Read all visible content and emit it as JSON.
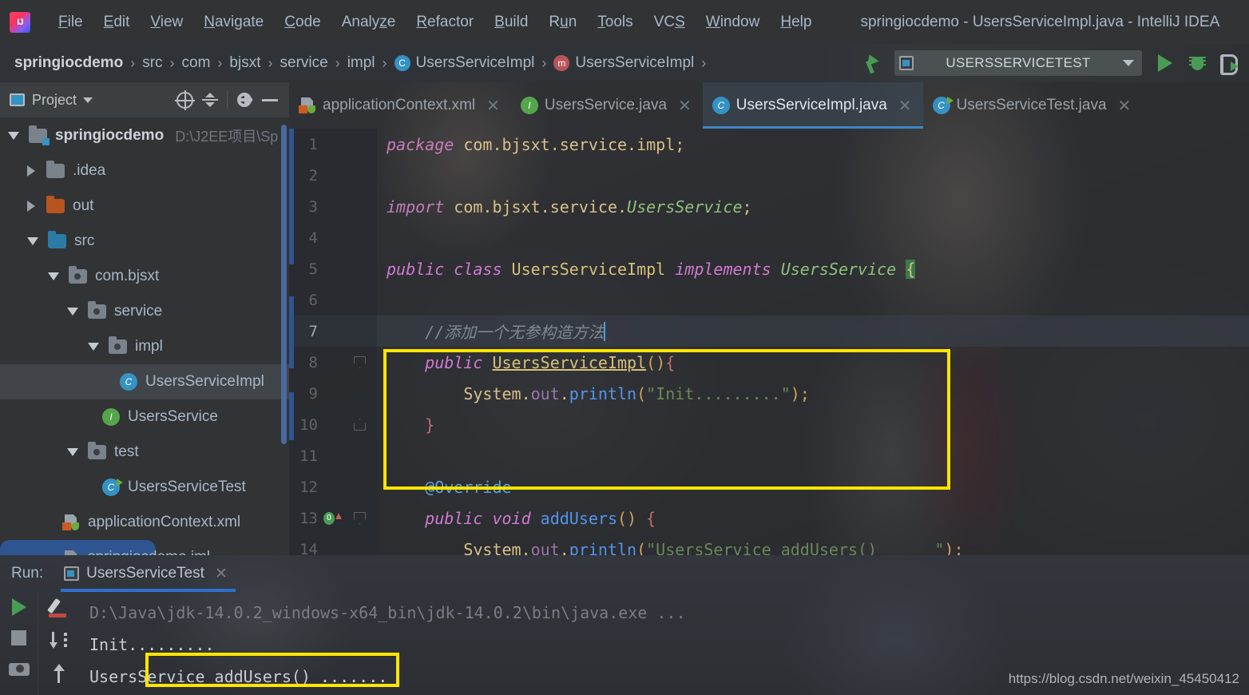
{
  "window": {
    "title": "springiocdemo - UsersServiceImpl.java - IntelliJ IDEA",
    "logo_icon": "intellij-idea-logo"
  },
  "menubar": {
    "items": [
      {
        "label": "File",
        "mnemonic": "F"
      },
      {
        "label": "Edit",
        "mnemonic": "E"
      },
      {
        "label": "View",
        "mnemonic": "V"
      },
      {
        "label": "Navigate",
        "mnemonic": "N"
      },
      {
        "label": "Code",
        "mnemonic": "C"
      },
      {
        "label": "Analyze",
        "mnemonic": "z"
      },
      {
        "label": "Refactor",
        "mnemonic": "R"
      },
      {
        "label": "Build",
        "mnemonic": "B"
      },
      {
        "label": "Run",
        "mnemonic": "u"
      },
      {
        "label": "Tools",
        "mnemonic": "T"
      },
      {
        "label": "VCS",
        "mnemonic": "S"
      },
      {
        "label": "Window",
        "mnemonic": "W"
      },
      {
        "label": "Help",
        "mnemonic": "H"
      }
    ]
  },
  "breadcrumb": {
    "separator": "›",
    "items": [
      {
        "label": "springiocdemo",
        "icon": null
      },
      {
        "label": "src",
        "icon": null
      },
      {
        "label": "com",
        "icon": null
      },
      {
        "label": "bjsxt",
        "icon": null
      },
      {
        "label": "service",
        "icon": null
      },
      {
        "label": "impl",
        "icon": null
      },
      {
        "label": "UsersServiceImpl",
        "icon": "class-icon"
      },
      {
        "label": "UsersServiceImpl",
        "icon": "method-icon"
      }
    ]
  },
  "toolbar": {
    "build_icon": "hammer-icon",
    "run_config": "USERSSERVICETEST",
    "run_config_icon": "run-config-icon",
    "dropdown_icon": "chevron-down-icon",
    "run_icon": "run-icon",
    "debug_icon": "debug-bug-icon",
    "coverage_icon": "run-with-coverage-icon"
  },
  "project_panel": {
    "title": "Project",
    "dropdown_icon": "chevron-down-icon",
    "actions": [
      {
        "name": "select-opened-file-icon"
      },
      {
        "name": "collapse-all-icon"
      },
      {
        "name": "gear-icon"
      },
      {
        "name": "hide-icon"
      }
    ],
    "tree": [
      {
        "label": "springiocdemo",
        "path": "D:\\J2EE项目\\Sp",
        "indent": 0,
        "state": "expanded",
        "icon": "module-folder-icon",
        "bold": true
      },
      {
        "label": ".idea",
        "path": "",
        "indent": 1,
        "state": "collapsed",
        "icon": "folder-grey-icon",
        "bold": false
      },
      {
        "label": "out",
        "path": "",
        "indent": 1,
        "state": "collapsed",
        "icon": "folder-orange-icon",
        "bold": false
      },
      {
        "label": "src",
        "path": "",
        "indent": 1,
        "state": "expanded",
        "icon": "folder-source-icon",
        "bold": false
      },
      {
        "label": "com.bjsxt",
        "path": "",
        "indent": 2,
        "state": "expanded",
        "icon": "package-icon",
        "bold": false
      },
      {
        "label": "service",
        "path": "",
        "indent": 3,
        "state": "expanded",
        "icon": "package-icon",
        "bold": false
      },
      {
        "label": "impl",
        "path": "",
        "indent": 4,
        "state": "expanded",
        "icon": "package-icon",
        "bold": false
      },
      {
        "label": "UsersServiceImpl",
        "path": "",
        "indent": 5,
        "state": "leaf",
        "icon": "class-icon",
        "bold": false,
        "selected": true
      },
      {
        "label": "UsersService",
        "path": "",
        "indent": 5,
        "state": "leaf",
        "icon": "interface-icon",
        "bold": false
      },
      {
        "label": "test",
        "path": "",
        "indent": 3,
        "state": "expanded",
        "icon": "package-icon",
        "bold": false
      },
      {
        "label": "UsersServiceTest",
        "path": "",
        "indent": 4,
        "state": "leaf",
        "icon": "test-class-icon",
        "bold": false
      },
      {
        "label": "applicationContext.xml",
        "path": "",
        "indent": 2,
        "state": "leaf",
        "icon": "spring-xml-icon",
        "bold": false
      },
      {
        "label": "springiocdemo.iml",
        "path": "",
        "indent": 2,
        "state": "leaf",
        "icon": "iml-file-icon",
        "bold": false,
        "highlighted": true
      }
    ]
  },
  "editor": {
    "tabs": [
      {
        "label": "applicationContext.xml",
        "icon": "spring-xml-icon",
        "active": false,
        "close_icon": "close-icon"
      },
      {
        "label": "UsersService.java",
        "icon": "interface-icon",
        "active": false,
        "close_icon": "close-icon"
      },
      {
        "label": "UsersServiceImpl.java",
        "icon": "class-icon",
        "active": true,
        "close_icon": "close-icon"
      },
      {
        "label": "UsersServiceTest.java",
        "icon": "test-class-icon",
        "active": false,
        "close_icon": "close-icon"
      }
    ],
    "current_line": 7,
    "lines": [
      {
        "n": 1,
        "tokens": [
          {
            "t": "package",
            "c": "kw2"
          },
          {
            "t": " com.bjsxt.service.impl;",
            "c": "plain"
          }
        ]
      },
      {
        "n": 2,
        "tokens": []
      },
      {
        "n": 3,
        "tokens": [
          {
            "t": "import",
            "c": "kw2"
          },
          {
            "t": " com.bjsxt.service.",
            "c": "plain"
          },
          {
            "t": "UsersService",
            "c": "cls-g"
          },
          {
            "t": ";",
            "c": "plain"
          }
        ]
      },
      {
        "n": 4,
        "tokens": []
      },
      {
        "n": 5,
        "tokens": [
          {
            "t": "public class",
            "c": "kwp"
          },
          {
            "t": " ",
            "c": "plain"
          },
          {
            "t": "UsersServiceImpl",
            "c": "cls-y"
          },
          {
            "t": " ",
            "c": "plain"
          },
          {
            "t": "implements",
            "c": "kwp"
          },
          {
            "t": " ",
            "c": "plain"
          },
          {
            "t": "UsersService",
            "c": "cls-g"
          },
          {
            "t": " ",
            "c": "plain"
          },
          {
            "t": "{",
            "c": "brace-hl"
          }
        ]
      },
      {
        "n": 6,
        "tokens": []
      },
      {
        "n": 7,
        "tokens": [
          {
            "t": "    //添加一个无参构造方法",
            "c": "cmt"
          }
        ]
      },
      {
        "n": 8,
        "tokens": [
          {
            "t": "    ",
            "c": "plain"
          },
          {
            "t": "public",
            "c": "kwp"
          },
          {
            "t": " ",
            "c": "plain"
          },
          {
            "t": "UsersServiceImpl",
            "c": "ulined"
          },
          {
            "t": "()",
            "c": "punct"
          },
          {
            "t": "{",
            "c": "brace"
          }
        ],
        "fold": "open"
      },
      {
        "n": 9,
        "tokens": [
          {
            "t": "        System",
            "c": "plain"
          },
          {
            "t": ".",
            "c": "plain"
          },
          {
            "t": "out",
            "c": "var"
          },
          {
            "t": ".",
            "c": "plain"
          },
          {
            "t": "println",
            "c": "mcall"
          },
          {
            "t": "(",
            "c": "punct"
          },
          {
            "t": "\"Init.........\"",
            "c": "str"
          },
          {
            "t": ")",
            "c": "punct"
          },
          {
            "t": ";",
            "c": "punct"
          }
        ]
      },
      {
        "n": 10,
        "tokens": [
          {
            "t": "    ",
            "c": "plain"
          },
          {
            "t": "}",
            "c": "brace"
          }
        ],
        "fold": "close"
      },
      {
        "n": 11,
        "tokens": []
      },
      {
        "n": 12,
        "tokens": [
          {
            "t": "    ",
            "c": "plain"
          },
          {
            "t": "@Override",
            "c": "anno"
          }
        ]
      },
      {
        "n": 13,
        "tokens": [
          {
            "t": "    ",
            "c": "plain"
          },
          {
            "t": "public void",
            "c": "kwp"
          },
          {
            "t": " ",
            "c": "plain"
          },
          {
            "t": "addUsers",
            "c": "mcall"
          },
          {
            "t": "()",
            "c": "punct"
          },
          {
            "t": " ",
            "c": "plain"
          },
          {
            "t": "{",
            "c": "brace"
          }
        ],
        "fold": "open",
        "gutter_mark": "override-marker"
      },
      {
        "n": 14,
        "tokens": [
          {
            "t": "        System",
            "c": "plain"
          },
          {
            "t": ".",
            "c": "plain"
          },
          {
            "t": "out",
            "c": "var"
          },
          {
            "t": ".",
            "c": "plain"
          },
          {
            "t": "println",
            "c": "mcall"
          },
          {
            "t": "(",
            "c": "punct"
          },
          {
            "t": "\"UsersService addUsers()      \"",
            "c": "str"
          },
          {
            "t": ");",
            "c": "punct"
          }
        ]
      }
    ],
    "highlight_box": {
      "color": "#ffe500",
      "label": "constructor-highlight"
    }
  },
  "run_panel": {
    "label": "Run:",
    "tab": {
      "label": "UsersServiceTest",
      "icon": "run-config-icon",
      "close_icon": "close-icon"
    },
    "left_actions": [
      {
        "name": "rerun-icon"
      },
      {
        "name": "stop-icon"
      },
      {
        "name": "print-screenshot-icon"
      }
    ],
    "right_actions": [
      {
        "name": "soft-wrap-toggle-icon"
      },
      {
        "name": "scroll-to-end-icon"
      },
      {
        "name": "scroll-to-top-icon"
      }
    ],
    "console_lines": [
      {
        "text": "D:\\Java\\jdk-14.0.2_windows-x64_bin\\jdk-14.0.2\\bin\\java.exe ...",
        "style": "dim"
      },
      {
        "text": "Init.........",
        "style": "out",
        "highlighted": true
      },
      {
        "text": "UsersService addUsers() .......",
        "style": "out"
      }
    ],
    "highlight_box": {
      "color": "#ffe500",
      "label": "init-output-highlight"
    }
  },
  "watermark": "https://blog.csdn.net/weixin_45450412"
}
